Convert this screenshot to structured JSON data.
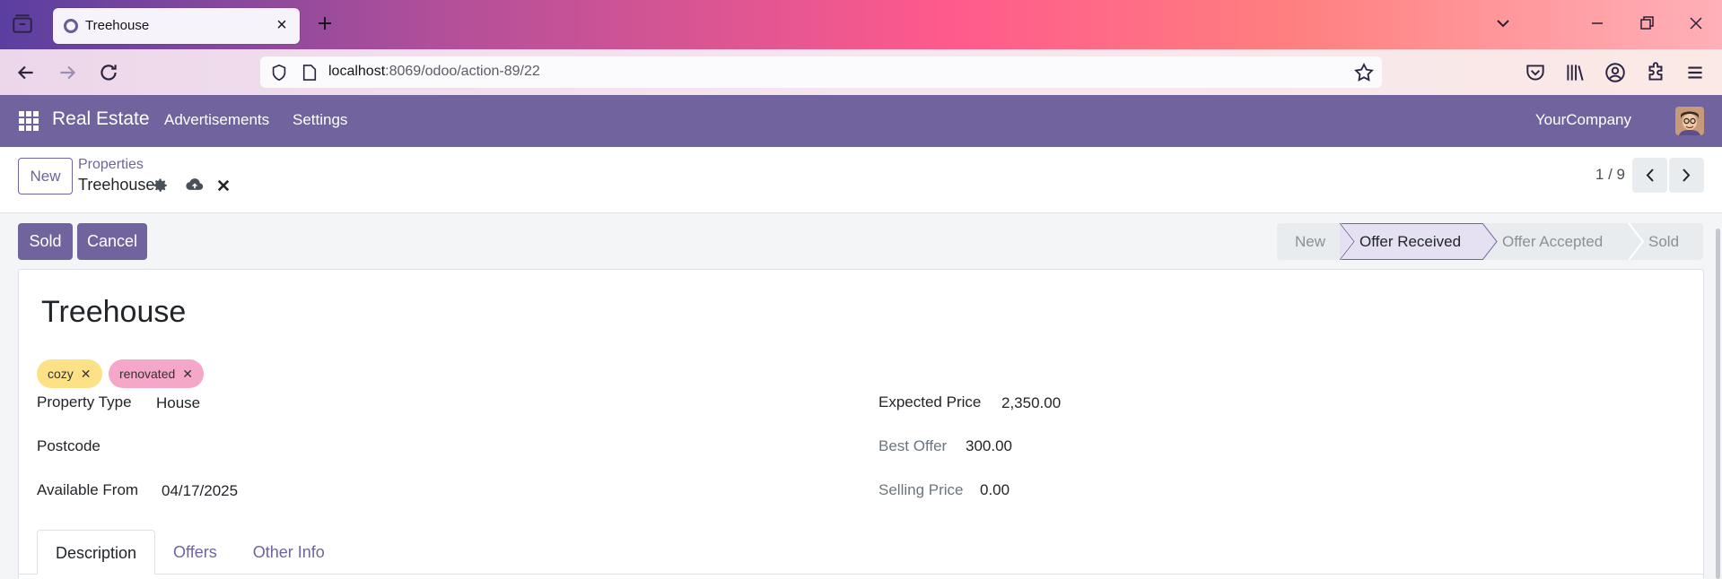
{
  "browser": {
    "tab_title": "Treehouse",
    "url_host": "localhost",
    "url_rest": ":8069/odoo/action-89/22"
  },
  "app": {
    "brand": "Real Estate",
    "menu": [
      "Advertisements",
      "Settings"
    ],
    "company": "YourCompany"
  },
  "control_panel": {
    "new_label": "New",
    "breadcrumb_parent": "Properties",
    "breadcrumb_current": "Treehouse",
    "pager": "1 / 9"
  },
  "statusbar": {
    "buttons": [
      "Sold",
      "Cancel"
    ],
    "stages": [
      "New",
      "Offer Received",
      "Offer Accepted",
      "Sold"
    ],
    "active_stage": "Offer Received"
  },
  "form": {
    "name": "Treehouse",
    "tags": [
      {
        "label": "cozy",
        "color": "#fde187"
      },
      {
        "label": "renovated",
        "color": "#f4a7c9"
      }
    ],
    "left_fields": [
      {
        "label": "Property Type",
        "value": "House"
      },
      {
        "label": "Postcode",
        "value": ""
      },
      {
        "label": "Available From",
        "value": "04/17/2025"
      }
    ],
    "right_fields": [
      {
        "label": "Expected Price",
        "value": "2,350.00"
      },
      {
        "label": "Best Offer",
        "value": "300.00"
      },
      {
        "label": "Selling Price",
        "value": "0.00"
      }
    ],
    "tabs": [
      "Description",
      "Offers",
      "Other Info"
    ],
    "active_tab": "Description"
  },
  "colors": {
    "brand_purple": "#71639e"
  }
}
